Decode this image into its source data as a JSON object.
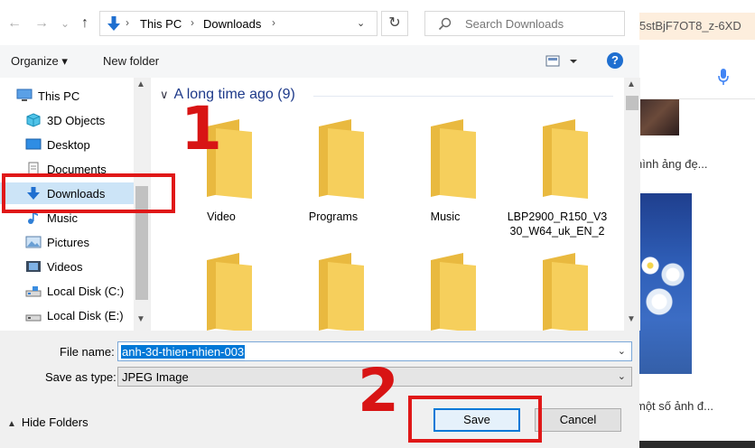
{
  "background_browser": {
    "url_fragment": "5stBjF7OT8_z-6XD",
    "caption_top": "hình ảng đẹ...",
    "caption_bottom": "một số ảnh đ..."
  },
  "toolbar": {
    "back": "←",
    "forward": "→",
    "recent": "⌄",
    "up": "↑",
    "breadcrumb": [
      "This PC",
      "Downloads"
    ],
    "refresh": "↻",
    "search_placeholder": "Search Downloads"
  },
  "commandbar": {
    "organize": "Organize ▾",
    "new_folder": "New folder",
    "help": "?"
  },
  "nav": {
    "items": [
      {
        "label": "This PC",
        "icon": "monitor-icon"
      },
      {
        "label": "3D Objects",
        "icon": "cube-icon"
      },
      {
        "label": "Desktop",
        "icon": "desktop-icon"
      },
      {
        "label": "Documents",
        "icon": "document-icon"
      },
      {
        "label": "Downloads",
        "icon": "download-arrow-icon",
        "selected": true
      },
      {
        "label": "Music",
        "icon": "music-note-icon"
      },
      {
        "label": "Pictures",
        "icon": "picture-icon"
      },
      {
        "label": "Videos",
        "icon": "film-icon"
      },
      {
        "label": "Local Disk (C:)",
        "icon": "drive-icon"
      },
      {
        "label": "Local Disk (E:)",
        "icon": "drive-icon"
      }
    ]
  },
  "content": {
    "group_header": "A long time ago (9)",
    "files": [
      "Video",
      "Programs",
      "Music",
      "LBP2900_R150_V330_W64_uk_EN_2",
      "",
      "",
      "",
      ""
    ]
  },
  "form": {
    "file_name_label": "File name:",
    "file_name_value": "anh-3d-thien-nhien-003",
    "save_type_label": "Save as type:",
    "save_type_value": "JPEG Image",
    "hide_folders": "Hide Folders",
    "save": "Save",
    "cancel": "Cancel"
  },
  "annotations": {
    "step1": "1",
    "step2": "2",
    "color": "#e01818"
  },
  "colors": {
    "folder": "#f6cf5c",
    "accent": "#0078d7",
    "selection": "#cce4f7"
  }
}
